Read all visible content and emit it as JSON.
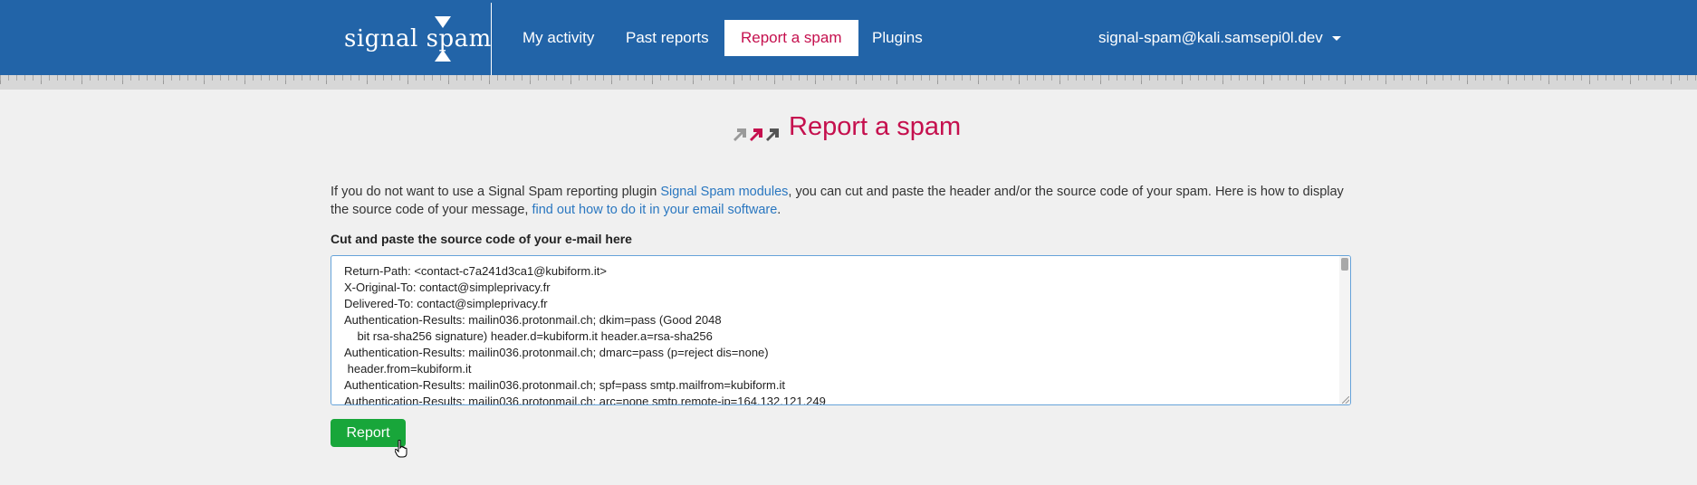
{
  "navbar": {
    "logo_text": "signal spam",
    "items": [
      {
        "label": "My activity",
        "active": false
      },
      {
        "label": "Past reports",
        "active": false
      },
      {
        "label": "Report a spam",
        "active": true
      },
      {
        "label": "Plugins",
        "active": false
      }
    ],
    "user_email": "signal-spam@kali.samsepi0l.dev"
  },
  "page": {
    "title": "Report a spam",
    "intro": {
      "part1": "If you do not want to use a Signal Spam reporting plugin ",
      "link1": "Signal Spam modules",
      "part2": ", you can cut and paste the header and/or the source code of your spam. Here is how to display the source code of your message, ",
      "link2": "find out how to do it in your email software",
      "part3": "."
    },
    "field_label": "Cut and paste the source code of your e-mail here",
    "source_lines": [
      "Return-Path: <contact-c7a241d3ca1@kubiform.it>",
      "X-Original-To: contact@simpleprivacy.fr",
      "Delivered-To: contact@simpleprivacy.fr",
      "Authentication-Results: mailin036.protonmail.ch; dkim=pass (Good 2048",
      "    bit rsa-sha256 signature) header.d=kubiform.it header.a=rsa-sha256",
      "Authentication-Results: mailin036.protonmail.ch; dmarc=pass (p=reject dis=none)",
      " header.from=kubiform.it",
      "Authentication-Results: mailin036.protonmail.ch; spf=pass smtp.mailfrom=kubiform.it",
      "Authentication-Results: mailin036.protonmail.ch; arc=none smtp.remote-ip=164.132.121.249"
    ],
    "report_button": "Report"
  },
  "colors": {
    "navbar": "#2264a8",
    "accent": "#c5104e",
    "link": "#2a77c0",
    "button": "#18a63a",
    "background": "#f0f0f0"
  },
  "icons": [
    "signal-spam-logo",
    "dropdown-caret-icon",
    "report-arrows-icon",
    "hand-pointer-cursor-icon"
  ]
}
